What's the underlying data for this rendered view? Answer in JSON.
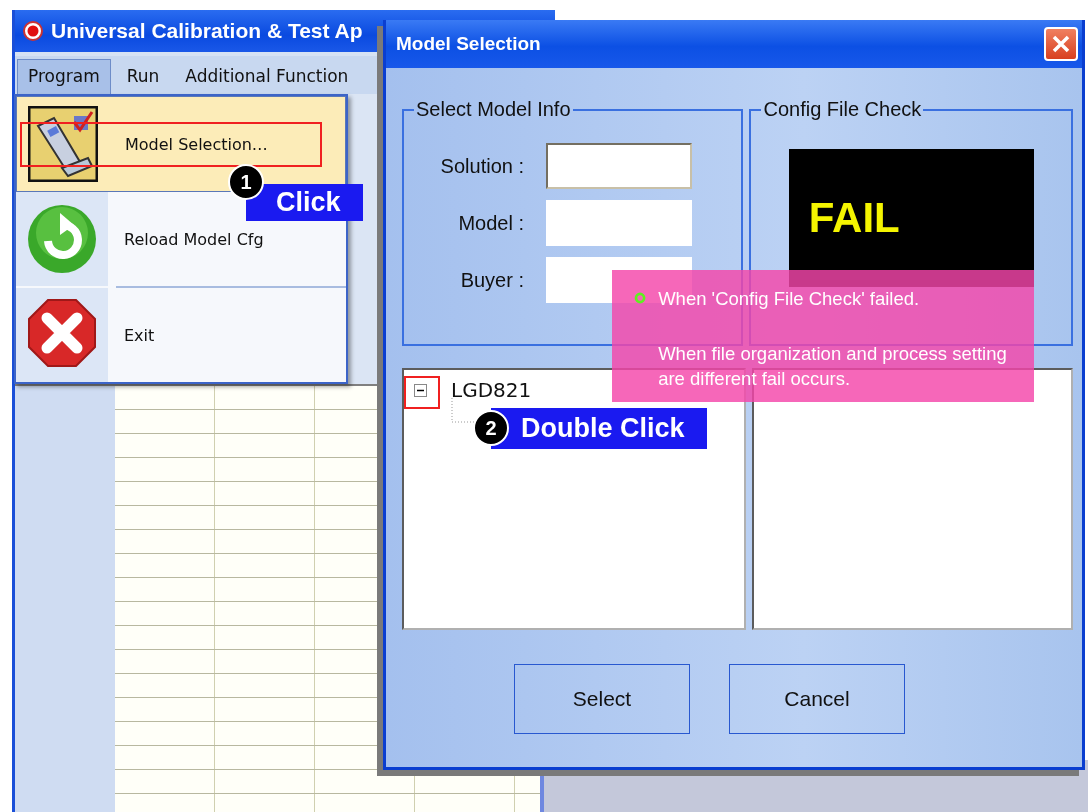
{
  "app_window": {
    "title": "Universal Calibration & Test Ap",
    "menu": [
      {
        "label": "Program",
        "selected": true
      },
      {
        "label": "Run",
        "selected": false
      },
      {
        "label": "Additional Function",
        "selected": false
      }
    ],
    "dropdown": [
      {
        "label": "Model Selection…",
        "selected": true
      },
      {
        "label": "Reload Model Cfg",
        "selected": false
      },
      {
        "label": "Exit",
        "selected": false
      }
    ]
  },
  "dialog": {
    "title": "Model Selection",
    "model_info": {
      "title": "Select Model Info",
      "fields": [
        {
          "label": "Solution :"
        },
        {
          "label": "Model :"
        },
        {
          "label": "Buyer :"
        }
      ]
    },
    "config_check": {
      "title": "Config File Check",
      "result": "FAIL"
    },
    "tree": [
      {
        "label": "LGD821",
        "expanded": true
      }
    ],
    "buttons": [
      "Select",
      "Cancel"
    ]
  },
  "annotations": [
    {
      "kind": "step",
      "number": "1",
      "label": "Click"
    },
    {
      "kind": "step",
      "number": "2",
      "label": "Double Click"
    },
    {
      "kind": "note",
      "lines": [
        "When 'Config File Check' failed.",
        "When file organization and process setting are different fail occurs."
      ]
    }
  ]
}
